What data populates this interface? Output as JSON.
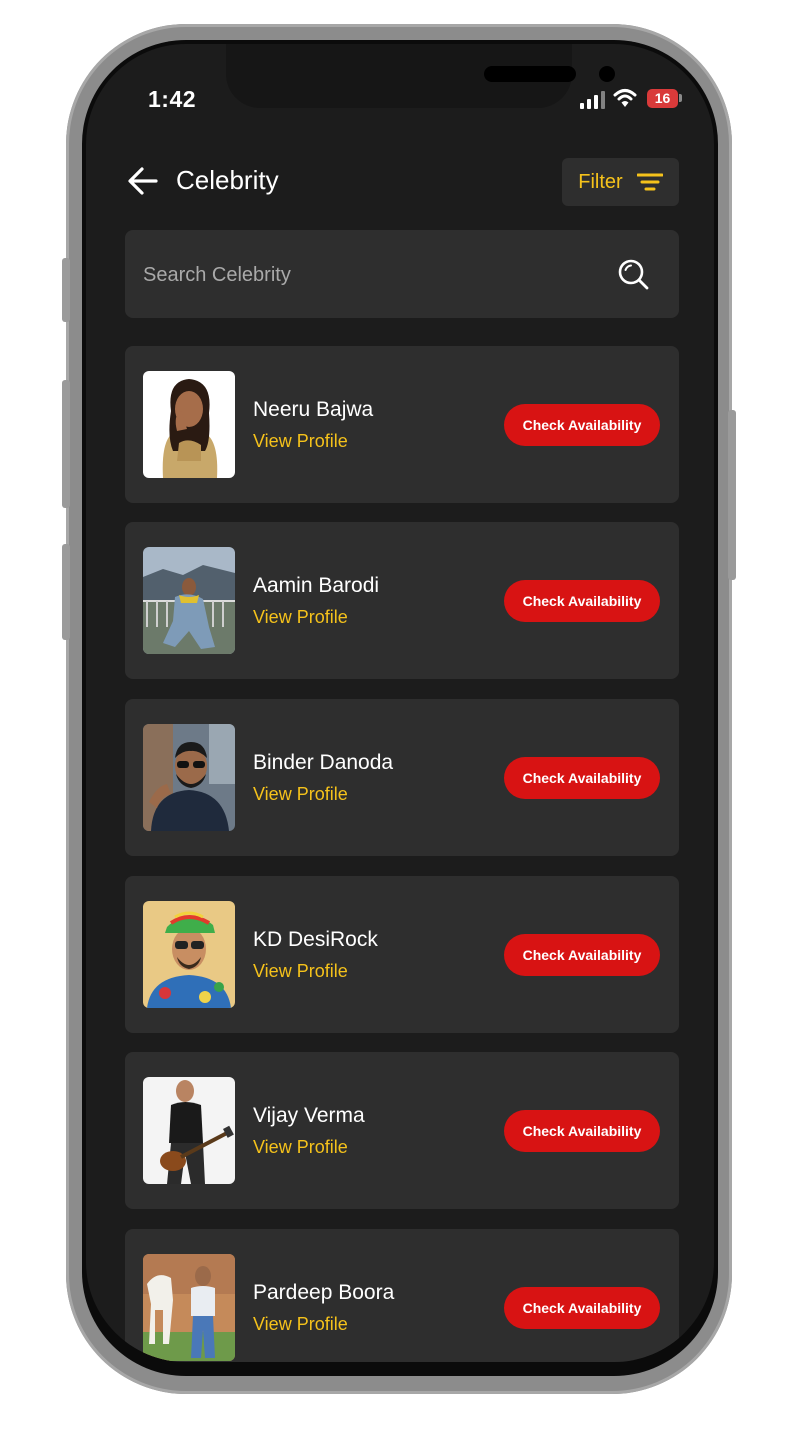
{
  "status_bar": {
    "time": "1:42",
    "battery": "16"
  },
  "header": {
    "title": "Celebrity",
    "filter_label": "Filter"
  },
  "search": {
    "placeholder": "Search Celebrity",
    "value": ""
  },
  "celebrities": [
    {
      "name": "Neeru Bajwa",
      "link": "View Profile",
      "action": "Check Availability"
    },
    {
      "name": "Aamin Barodi",
      "link": "View Profile",
      "action": "Check Availability"
    },
    {
      "name": "Binder Danoda",
      "link": "View Profile",
      "action": "Check Availability"
    },
    {
      "name": "KD DesiRock",
      "link": "View Profile",
      "action": "Check Availability"
    },
    {
      "name": "Vijay Verma",
      "link": "View Profile",
      "action": "Check Availability"
    },
    {
      "name": "Pardeep Boora",
      "link": "View Profile",
      "action": "Check Availability"
    }
  ],
  "colors": {
    "accent": "#f5c21b",
    "action": "#d81313",
    "card": "#2e2e2e",
    "background": "#1c1c1c"
  },
  "icons": {
    "back": "arrow-left-icon",
    "filter": "filter-lines-icon",
    "search": "magnifier-icon",
    "signal": "cellular-signal-icon",
    "wifi": "wifi-icon",
    "battery": "battery-icon"
  }
}
